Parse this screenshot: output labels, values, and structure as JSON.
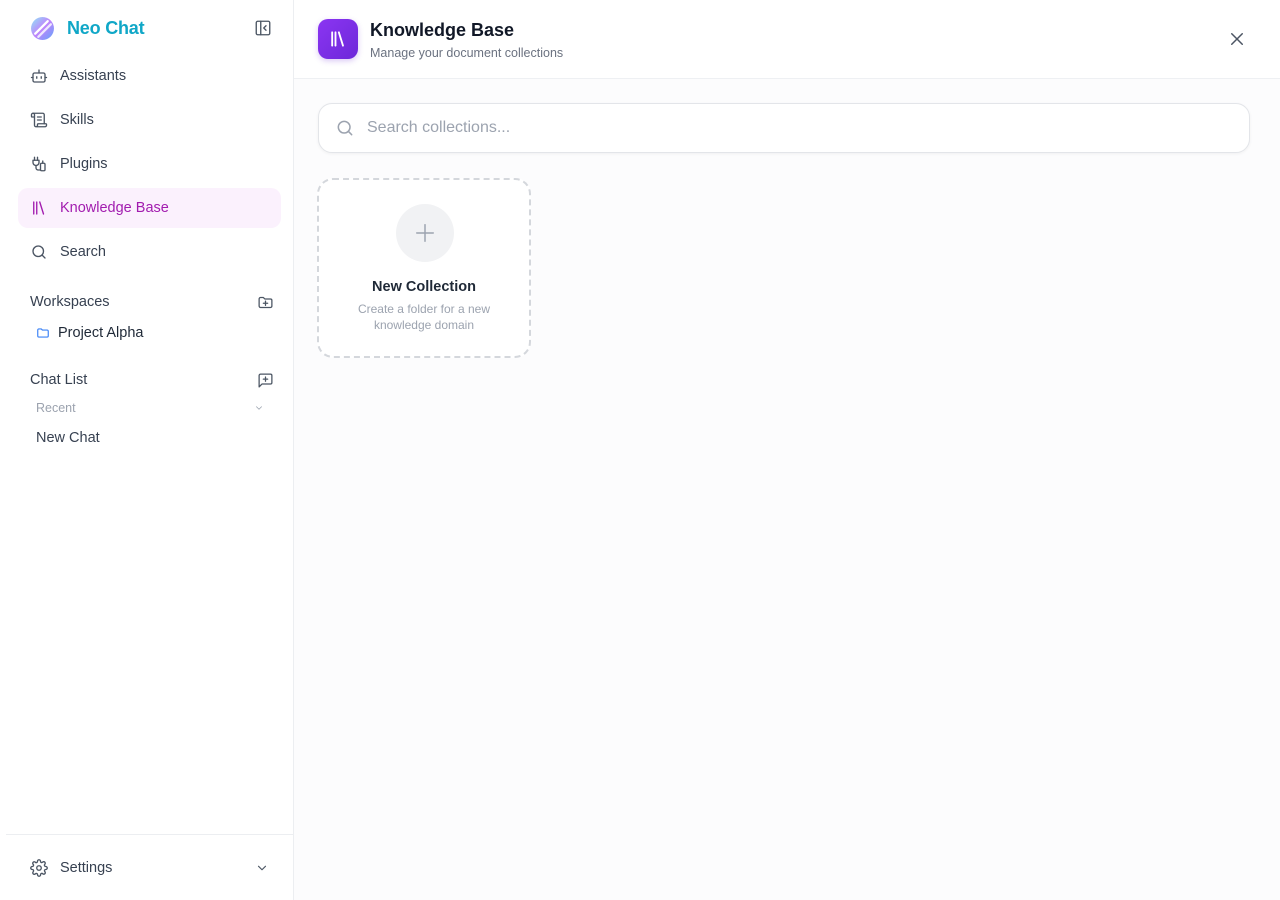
{
  "sidebar": {
    "brand": {
      "name": "Neo Chat",
      "logo_icon": "neo-chat-logo-icon",
      "color": "#10a7c7"
    },
    "collapse_icon": "sidebar-collapse-icon",
    "nav": [
      {
        "label": "Assistants",
        "icon": "bot-icon",
        "active": false
      },
      {
        "label": "Skills",
        "icon": "scroll-icon",
        "active": false
      },
      {
        "label": "Plugins",
        "icon": "plug-icon",
        "active": false
      },
      {
        "label": "Knowledge Base",
        "icon": "library-icon",
        "active": true
      },
      {
        "label": "Search",
        "icon": "search-icon",
        "active": false
      }
    ],
    "workspaces": {
      "label": "Workspaces",
      "add_icon": "folder-plus-icon",
      "items": [
        {
          "label": "Project Alpha",
          "icon": "folder-icon"
        }
      ]
    },
    "chat_list": {
      "label": "Chat List",
      "add_icon": "message-plus-icon",
      "group_label": "Recent",
      "items": [
        {
          "label": "New Chat"
        }
      ]
    },
    "settings": {
      "label": "Settings",
      "icon": "gear-icon"
    }
  },
  "main": {
    "header": {
      "title": "Knowledge Base",
      "subtitle": "Manage your document collections",
      "badge_icon": "library-icon",
      "close_icon": "close-icon"
    },
    "search": {
      "placeholder": "Search collections...",
      "value": ""
    },
    "new_collection": {
      "title": "New Collection",
      "description": "Create a folder for a new knowledge domain",
      "icon": "plus-icon"
    }
  },
  "colors": {
    "accent": "#a21caf",
    "active_bg": "#fbf1fd",
    "badge": "#7c3aed",
    "folder": "#3b82f6"
  }
}
